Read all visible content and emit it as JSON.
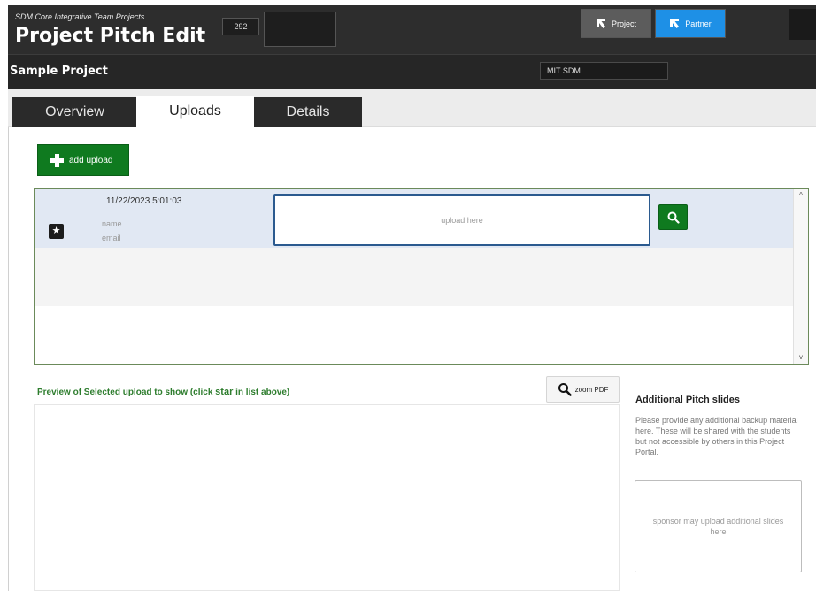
{
  "header": {
    "subtitle": "SDM Core Integrative Team Projects",
    "title": "Project Pitch Edit",
    "id_value": "292",
    "project_button": "Project",
    "partner_button": "Partner",
    "project_name": "Sample Project",
    "org_value": "MIT SDM"
  },
  "tabs": {
    "overview": "Overview",
    "uploads": "Uploads",
    "details": "Details",
    "active": "Uploads"
  },
  "uploads": {
    "add_label": "add upload",
    "rows": [
      {
        "timestamp": "11/22/2023 5:01:03",
        "name_placeholder": "name",
        "email_placeholder": "email",
        "upload_placeholder": "upload here"
      }
    ]
  },
  "preview": {
    "label_before": "Preview of Selected upload to show (click ",
    "label_star": "star",
    "label_after": " in list above)",
    "zoom_label": "zoom PDF"
  },
  "additional": {
    "title": "Additional Pitch slides",
    "description": "Please provide any additional backup material here. These will be shared with the students but not accessible by others in this Project Portal.",
    "placeholder": "sponsor may upload additional slides here"
  },
  "colors": {
    "header_bg": "#2d2d2d",
    "accent_green": "#0f7a1f",
    "accent_blue": "#1e90e6",
    "selected_row": "#e1e8f3",
    "upload_border": "#2b5a8f"
  },
  "icons": {
    "project": "arrow-icon",
    "partner": "arrow-icon",
    "add": "plus-icon",
    "star": "star-icon",
    "search": "search-icon",
    "zoom": "magnifier-icon"
  }
}
